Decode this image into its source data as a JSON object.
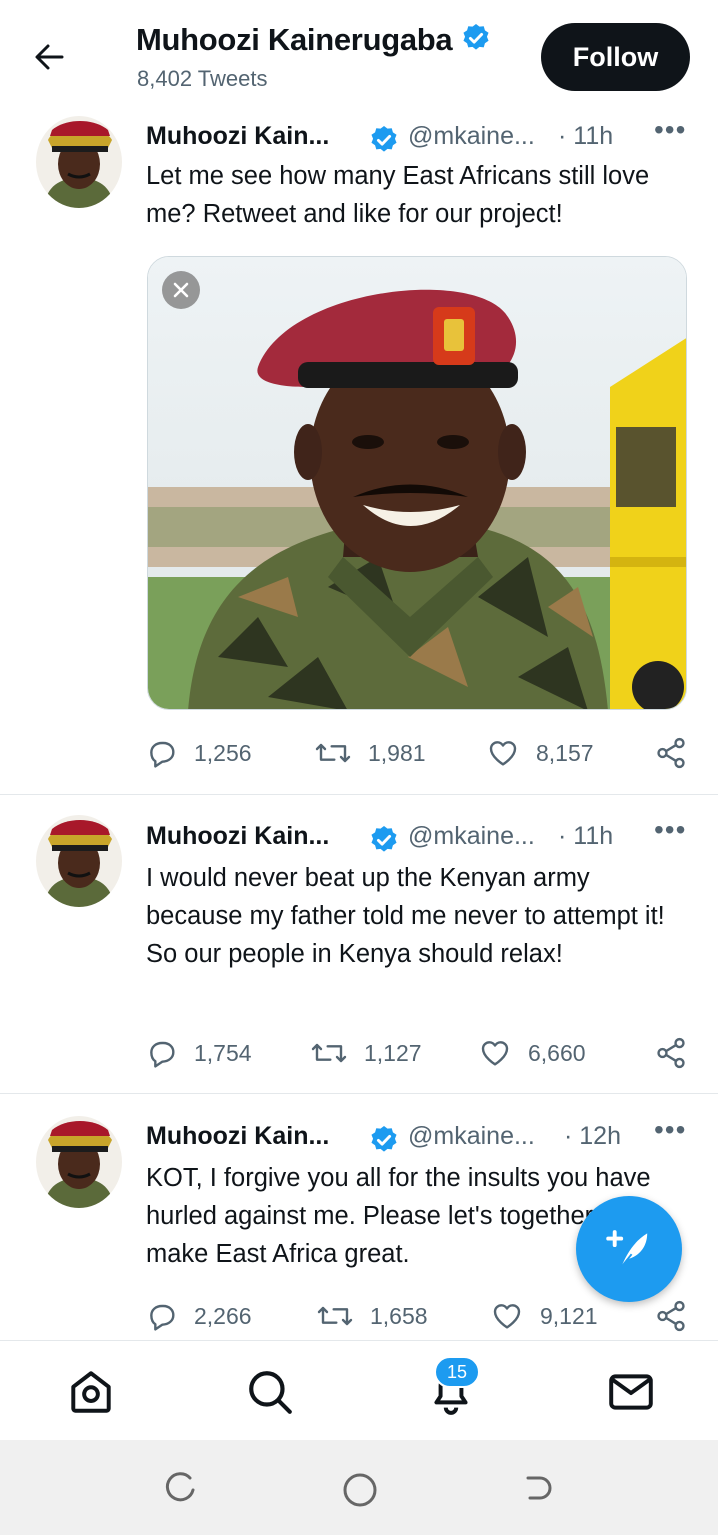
{
  "header": {
    "title": "Muhoozi Kainerugaba",
    "tweet_count": "8,402 Tweets",
    "follow_label": "Follow"
  },
  "tweets": [
    {
      "name": "Muhoozi Kain...",
      "handle": "@mkaine...",
      "time": "· 11h",
      "text": "Let me see how many East Africans still love me? Retweet and like for our project!",
      "has_media": true,
      "replies": "1,256",
      "retweets": "1,981",
      "likes": "8,157"
    },
    {
      "name": "Muhoozi Kain...",
      "handle": "@mkaine...",
      "time": "· 11h",
      "text": "I would never beat up the Kenyan army because my father told me never to attempt it! So our people in Kenya should relax!",
      "has_media": false,
      "replies": "1,754",
      "retweets": "1,127",
      "likes": "6,660"
    },
    {
      "name": "Muhoozi Kain...",
      "handle": "@mkaine...",
      "time": "· 12h",
      "text": "KOT, I forgive you all for the insults you have hurled against me. Please let's together to make East Africa great.",
      "has_media": false,
      "replies": "2,266",
      "retweets": "1,658",
      "likes": "9,121"
    }
  ],
  "bottom_nav": {
    "items": [
      "home-icon",
      "search-icon",
      "notifications-icon",
      "messages-icon"
    ],
    "notification_badge": "15"
  },
  "colors": {
    "accent": "#1d9bf0",
    "text": "#0f1419",
    "secondary": "#536471"
  }
}
